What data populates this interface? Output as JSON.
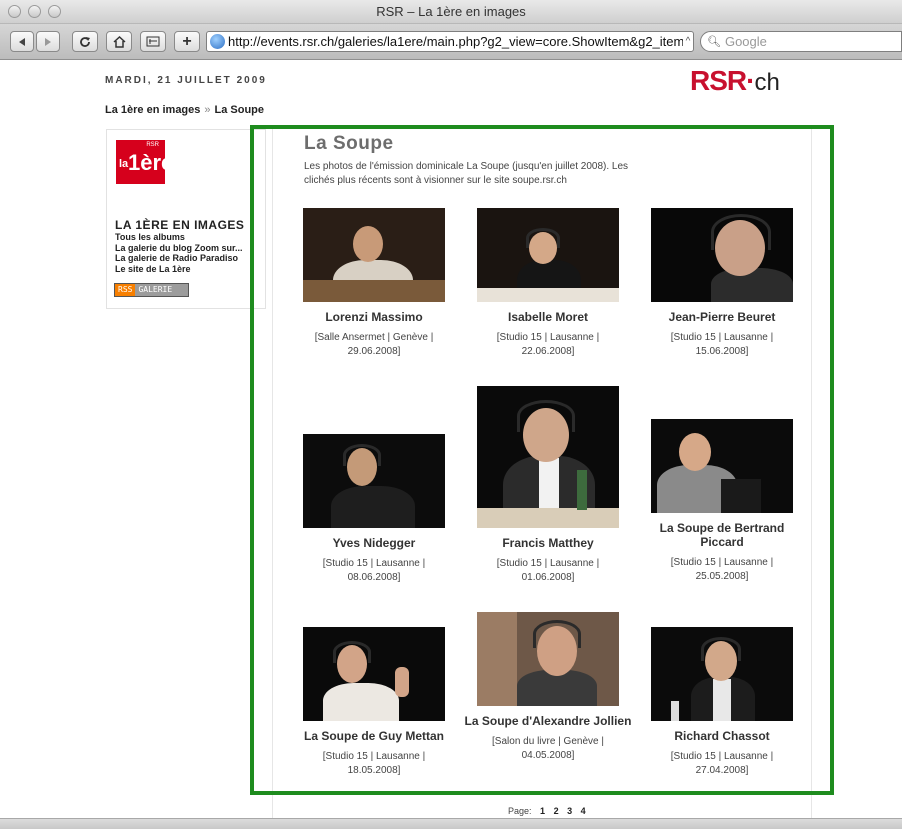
{
  "window": {
    "title": "RSR – La 1ère en images"
  },
  "toolbar": {
    "url": "http://events.rsr.ch/galeries/la1ere/main.php?g2_view=core.ShowItem&g2_itemId=",
    "search_placeholder": "Google"
  },
  "header": {
    "date": "MARDI, 21 JUILLET 2009",
    "logo_main": "RSR",
    "logo_suffix": "ch",
    "breadcrumb": [
      "La 1ère en images",
      "La Soupe"
    ]
  },
  "sidebar": {
    "logo_rsr": "RSR",
    "logo_la": "la",
    "logo_1ere": "1ère",
    "title": "LA 1ÈRE EN IMAGES",
    "links": [
      "Tous les albums",
      "La galerie du blog Zoom sur...",
      "La galerie de Radio Paradiso",
      "Le site de La 1ère"
    ],
    "badge_left": "RSS",
    "badge_right": "GALERIE"
  },
  "gallery": {
    "title": "La Soupe",
    "description": "Les photos de l'émission dominicale La Soupe (jusqu'en juillet 2008). Les clichés plus récents sont à visionner sur le site soupe.rsr.ch",
    "items": [
      {
        "name": "Lorenzi Massimo",
        "info_1": "[Salle Ansermet | Genève |",
        "info_2": "29.06.2008]"
      },
      {
        "name": "Isabelle Moret",
        "info_1": "[Studio 15 | Lausanne |",
        "info_2": "22.06.2008]"
      },
      {
        "name": "Jean-Pierre Beuret",
        "info_1": "[Studio 15 | Lausanne |",
        "info_2": "15.06.2008]"
      },
      {
        "name": "Yves Nidegger",
        "info_1": "[Studio 15 | Lausanne |",
        "info_2": "08.06.2008]"
      },
      {
        "name": "Francis Matthey",
        "info_1": "[Studio 15 | Lausanne |",
        "info_2": "01.06.2008]"
      },
      {
        "name": "La Soupe de Bertrand Piccard",
        "info_1": "[Studio 15 | Lausanne |",
        "info_2": "25.05.2008]"
      },
      {
        "name": "La Soupe de Guy Mettan",
        "info_1": "[Studio 15 | Lausanne |",
        "info_2": "18.05.2008]"
      },
      {
        "name": "La Soupe d'Alexandre Jollien",
        "info_1": "[Salon du livre | Genève |",
        "info_2": "04.05.2008]"
      },
      {
        "name": "Richard Chassot",
        "info_1": "[Studio 15 | Lausanne |",
        "info_2": "27.04.2008]"
      }
    ]
  },
  "pager": {
    "label": "Page:",
    "pages": [
      "1",
      "2",
      "3",
      "4"
    ]
  }
}
